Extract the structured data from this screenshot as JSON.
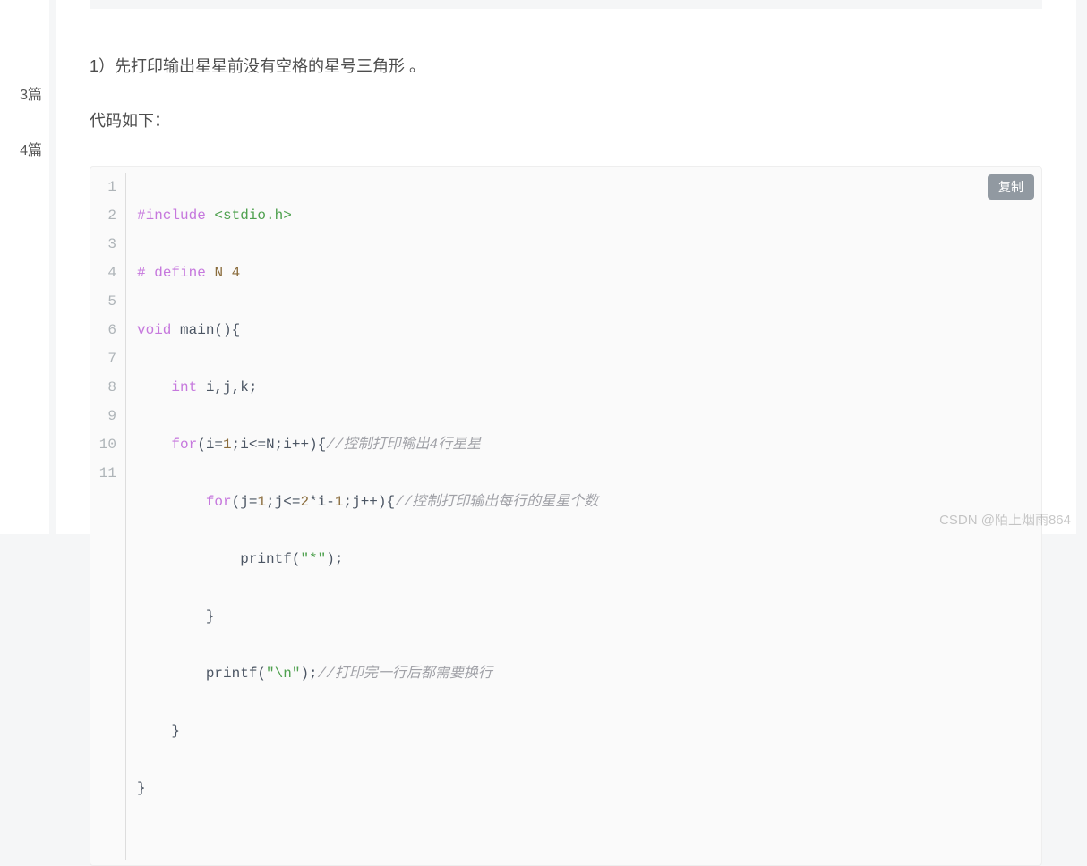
{
  "sidebar": {
    "items": [
      {
        "label": "3篇"
      },
      {
        "label": "4篇"
      }
    ]
  },
  "article": {
    "para1": "1）先打印输出星星前没有空格的星号三角形 。",
    "para2": "代码如下：",
    "copy_label": "复制",
    "code": {
      "line_numbers": [
        "1",
        "2",
        "3",
        "4",
        "5",
        "6",
        "7",
        "8",
        "9",
        "10",
        "11"
      ],
      "line1": {
        "include_kw": "#include",
        "header": "<stdio.h>"
      },
      "line2": {
        "hash": "#",
        "define_kw": "define",
        "name": "N",
        "val": "4"
      },
      "line3": {
        "type": "void",
        "rest": " main(){"
      },
      "line4": {
        "indent": "    ",
        "type": "int",
        "rest": " i,j,k;"
      },
      "line5": {
        "indent": "    ",
        "for_kw": "for",
        "p1": "(i=",
        "n1": "1",
        "p2": ";i<=N;i++){",
        "comment": "//控制打印输出4行星星"
      },
      "line6": {
        "indent": "        ",
        "for_kw": "for",
        "p1": "(j=",
        "n1": "1",
        "p2": ";j<=",
        "n2": "2",
        "p3": "*i-",
        "n3": "1",
        "p4": ";j++){",
        "comment": "//控制打印输出每行的星星个数"
      },
      "line7": {
        "indent": "            ",
        "fn": "printf(",
        "str": "\"*\"",
        "end": ");"
      },
      "line8": {
        "indent": "        ",
        "brace": "}"
      },
      "line9": {
        "indent": "        ",
        "fn": "printf(",
        "str": "\"\\n\"",
        "end": ");",
        "comment": "//打印完一行后都需要换行"
      },
      "line10": {
        "indent": "    ",
        "brace": "}"
      },
      "line11": {
        "brace": "}"
      }
    }
  },
  "watermark": "CSDN @陌上烟雨864"
}
